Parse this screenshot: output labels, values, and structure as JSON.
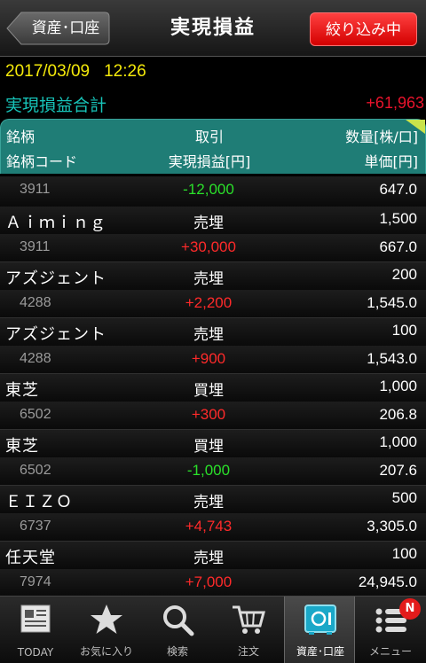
{
  "header": {
    "back_label": "資産･口座",
    "title": "実現損益",
    "filter_label": "絞り込み中"
  },
  "summary": {
    "date": "2017/03/09",
    "time": "12:26",
    "total_label": "実現損益合計",
    "total_value": "+61,963"
  },
  "columns": {
    "name": "銘柄",
    "trade": "取引",
    "quantity": "数量[株/口]",
    "code": "銘柄コード",
    "realized_pl": "実現損益[円]",
    "unit_price": "単価[円]"
  },
  "rows": [
    {
      "name": "",
      "type": "",
      "qty": "",
      "code": "3911",
      "pl": "-12,000",
      "price": "647.0"
    },
    {
      "name": "Ａｉｍｉｎｇ",
      "type": "売埋",
      "qty": "1,500",
      "code": "3911",
      "pl": "+30,000",
      "price": "667.0"
    },
    {
      "name": "アズジェント",
      "type": "売埋",
      "qty": "200",
      "code": "4288",
      "pl": "+2,200",
      "price": "1,545.0"
    },
    {
      "name": "アズジェント",
      "type": "売埋",
      "qty": "100",
      "code": "4288",
      "pl": "+900",
      "price": "1,543.0"
    },
    {
      "name": "東芝",
      "type": "買埋",
      "qty": "1,000",
      "code": "6502",
      "pl": "+300",
      "price": "206.8"
    },
    {
      "name": "東芝",
      "type": "買埋",
      "qty": "1,000",
      "code": "6502",
      "pl": "-1,000",
      "price": "207.6"
    },
    {
      "name": "ＥＩＺＯ",
      "type": "売埋",
      "qty": "500",
      "code": "6737",
      "pl": "+4,743",
      "price": "3,305.0"
    },
    {
      "name": "任天堂",
      "type": "売埋",
      "qty": "100",
      "code": "7974",
      "pl": "+7,000",
      "price": "24,945.0"
    }
  ],
  "colors": {
    "positive": "#ff2a2a",
    "negative": "#2ae02a",
    "accent_teal": "#1f7d76",
    "date_yellow": "#f4e90a"
  },
  "nav": [
    {
      "label": "TODAY",
      "icon": "newspaper-icon"
    },
    {
      "label": "お気に入り",
      "icon": "star-icon"
    },
    {
      "label": "検索",
      "icon": "search-icon"
    },
    {
      "label": "注文",
      "icon": "cart-icon"
    },
    {
      "label": "資産･口座",
      "icon": "safe-icon",
      "active": true
    },
    {
      "label": "メニュー",
      "icon": "menu-icon",
      "badge": "N"
    }
  ]
}
